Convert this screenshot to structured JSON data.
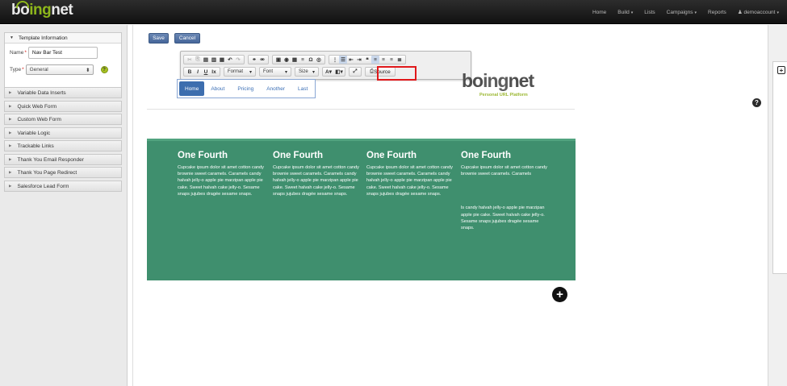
{
  "brand": {
    "name_part1": "bo",
    "name_part2": "ing",
    "name_part3": "net"
  },
  "topnav": {
    "items": [
      {
        "label": "Home"
      },
      {
        "label": "Build"
      },
      {
        "label": "Lists"
      },
      {
        "label": "Campaigns"
      },
      {
        "label": "Reports"
      },
      {
        "label": "demoaccount"
      }
    ]
  },
  "sidebar": {
    "open_panel": {
      "title": "Template Information",
      "name_label": "Name",
      "name_value": "Nav Bar Test",
      "type_label": "Type",
      "type_value": "General",
      "required_mark": "*"
    },
    "items": [
      {
        "label": "Variable Data Inserts"
      },
      {
        "label": "Quick Web Form"
      },
      {
        "label": "Custom Web Form"
      },
      {
        "label": "Variable Logic"
      },
      {
        "label": "Trackable Links"
      },
      {
        "label": "Thank You Email Responder"
      },
      {
        "label": "Thank You Page Redirect"
      },
      {
        "label": "Salesforce Lead Form"
      }
    ]
  },
  "actions": {
    "save": "Save",
    "cancel": "Cancel"
  },
  "editor_toolbar": {
    "format": "Format",
    "font": "Font",
    "size": "Size",
    "source": "Source"
  },
  "nav_demo": {
    "items": [
      {
        "label": "Home"
      },
      {
        "label": "About"
      },
      {
        "label": "Pricing"
      },
      {
        "label": "Another"
      },
      {
        "label": "Last"
      }
    ]
  },
  "canvas_brand": {
    "word1": "bo",
    "word2": "ing",
    "word3": "net",
    "tagline": "Personal URL Platform"
  },
  "columns": [
    {
      "heading": "One Fourth",
      "text": "Cupcake ipsum dolor sit amet cotton candy brownie sweet caramels. Caramels candy halvah jelly-o apple pie marzipan apple pie cake. Sweet halvah cake jelly-o. Sesame snaps jujubes dragée sesame snaps."
    },
    {
      "heading": "One Fourth",
      "text": "Cupcake ipsum dolor sit amet cotton candy brownie sweet caramels. Caramels candy halvah jelly-o apple pie marzipan apple pie cake. Sweet halvah cake jelly-o. Sesame snaps jujubes dragée sesame snaps."
    },
    {
      "heading": "One Fourth",
      "text": "Cupcake ipsum dolor sit amet cotton candy brownie sweet caramels. Caramels candy halvah jelly-o apple pie marzipan apple pie cake. Sweet halvah cake jelly-o. Sesame snaps jujubes dragée sesame snaps."
    },
    {
      "heading": "One Fourth",
      "text": "Cupcake ipsum dolor sit amet cotton candy brownie sweet caramels. Caramels",
      "text2": "ls candy halvah jelly-o apple pie marzipan apple pie cake. Sweet halvah cake jelly-o. Sesame snaps jujubes dragée sesame snaps."
    }
  ],
  "colors": {
    "navbar": "#1a1a1a",
    "brand_green": "#8db61b",
    "section_green": "#3f8f6e",
    "button_blue": "#46669a",
    "highlight_red": "#e0181b"
  }
}
